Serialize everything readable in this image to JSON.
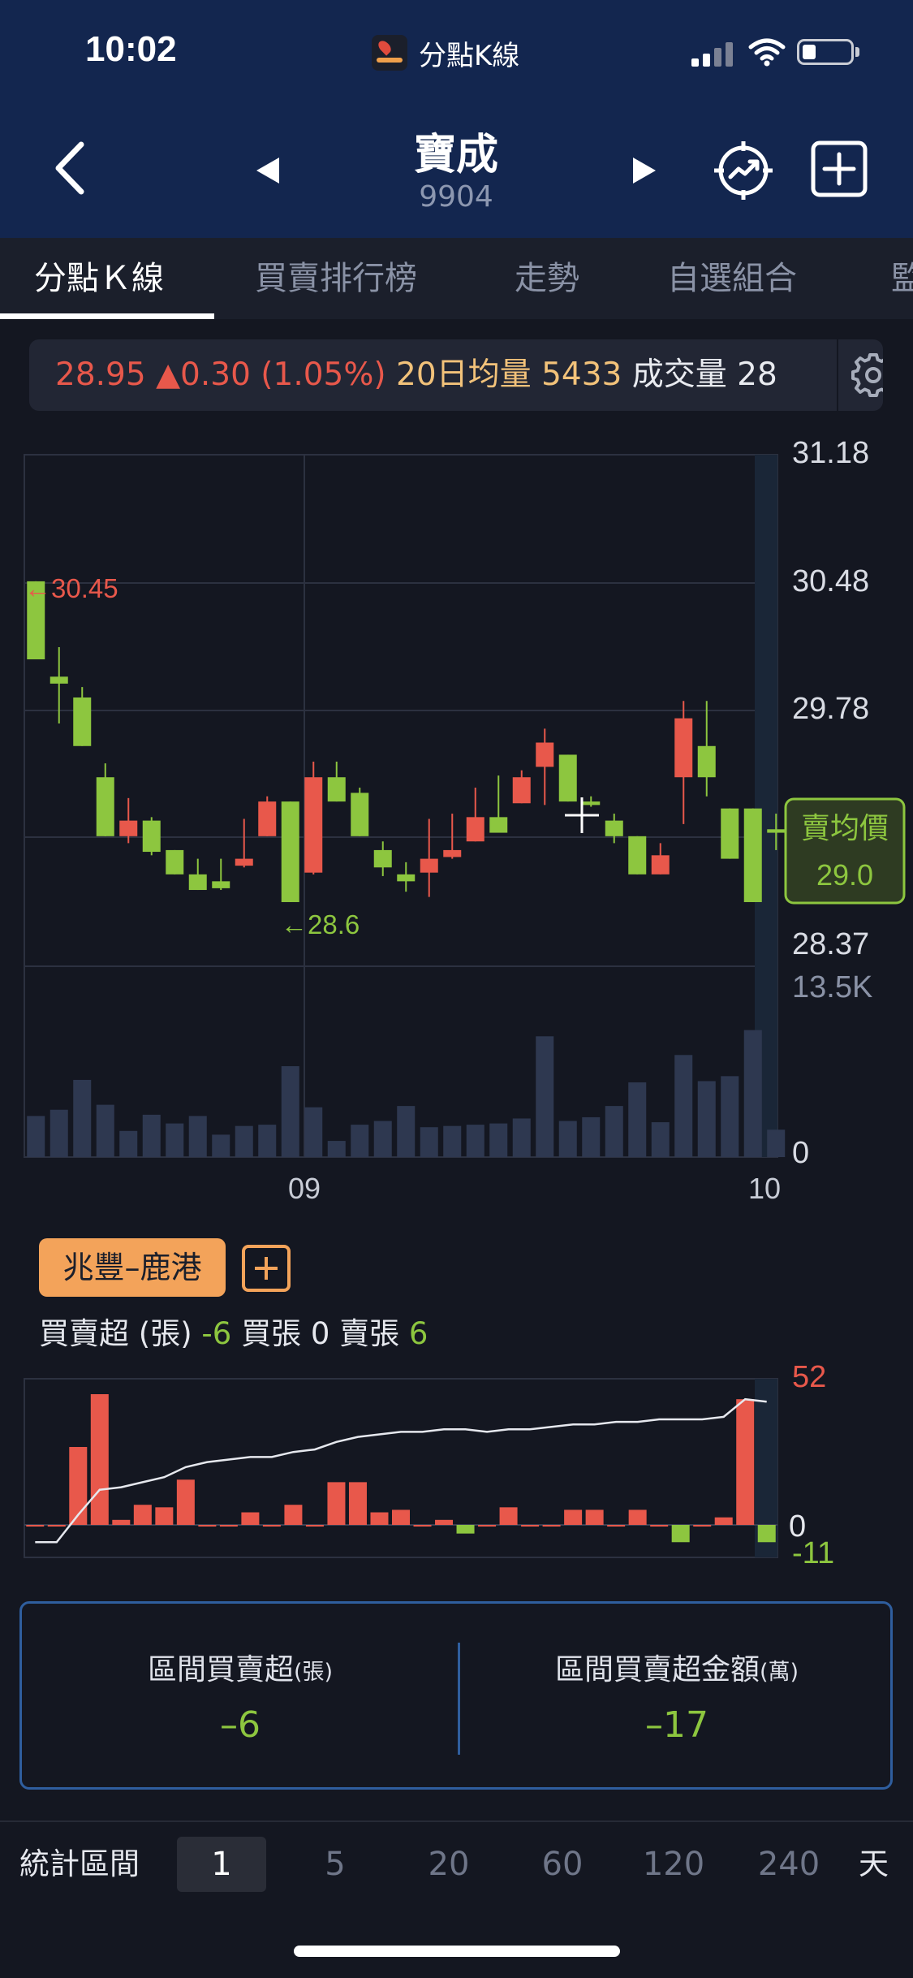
{
  "status_bar": {
    "time": "10:02",
    "app_name": "分點K線"
  },
  "header": {
    "stock_name": "寶成",
    "stock_code": "9904"
  },
  "tabs": [
    {
      "label": "分點Ｋ線",
      "active": true
    },
    {
      "label": "買賣排行榜",
      "active": false
    },
    {
      "label": "走勢",
      "active": false
    },
    {
      "label": "自選組合",
      "active": false
    },
    {
      "label": "監",
      "active": false
    }
  ],
  "ticker": {
    "price": "28.95",
    "change": "▲0.30 (1.05%)",
    "avg_label": "20日均量",
    "avg_value": "5433",
    "volume_label": "成交量",
    "volume_value": "28"
  },
  "colors": {
    "up": "#e8584b",
    "down": "#8dc63f",
    "accent": "#f3a35a",
    "volume": "#2e3850",
    "header": "#13264f"
  },
  "chart_data": [
    {
      "type": "candlestick",
      "y_ticks": [
        "31.18",
        "30.48",
        "29.78",
        "28.37"
      ],
      "ylim": [
        28.23,
        31.18
      ],
      "volume_ticks": [
        "13.5K",
        "0"
      ],
      "volume_max": 13500,
      "x_ticks": [
        "09",
        "10"
      ],
      "high_label": "30.45",
      "low_label": "28.6",
      "badge": {
        "label": "賣均價",
        "value": "29.0"
      },
      "candles": [
        {
          "o": 30.45,
          "c": 30.0,
          "h": 30.45,
          "l": 30.0,
          "v": 3300
        },
        {
          "o": 29.9,
          "c": 29.86,
          "h": 30.07,
          "l": 29.63,
          "v": 3800
        },
        {
          "o": 29.78,
          "c": 29.5,
          "h": 29.84,
          "l": 29.5,
          "v": 6200
        },
        {
          "o": 29.32,
          "c": 28.98,
          "h": 29.4,
          "l": 28.98,
          "v": 4200
        },
        {
          "o": 28.98,
          "c": 29.07,
          "h": 29.2,
          "l": 28.94,
          "v": 2100
        },
        {
          "o": 29.07,
          "c": 28.89,
          "h": 29.09,
          "l": 28.87,
          "v": 3400
        },
        {
          "o": 28.9,
          "c": 28.76,
          "h": 28.9,
          "l": 28.76,
          "v": 2700
        },
        {
          "o": 28.76,
          "c": 28.67,
          "h": 28.85,
          "l": 28.67,
          "v": 3300
        },
        {
          "o": 28.72,
          "c": 28.68,
          "h": 28.85,
          "l": 28.67,
          "v": 1800
        },
        {
          "o": 28.81,
          "c": 28.85,
          "h": 29.08,
          "l": 28.8,
          "v": 2500
        },
        {
          "o": 28.98,
          "c": 29.18,
          "h": 29.21,
          "l": 28.98,
          "v": 2600
        },
        {
          "o": 29.18,
          "c": 28.6,
          "h": 29.18,
          "l": 28.6,
          "v": 7300
        },
        {
          "o": 28.77,
          "c": 29.32,
          "h": 29.41,
          "l": 28.76,
          "v": 4000
        },
        {
          "o": 29.32,
          "c": 29.18,
          "h": 29.41,
          "l": 29.18,
          "v": 1300
        },
        {
          "o": 29.23,
          "c": 28.98,
          "h": 29.26,
          "l": 28.98,
          "v": 2600
        },
        {
          "o": 28.9,
          "c": 28.8,
          "h": 28.95,
          "l": 28.75,
          "v": 2900
        },
        {
          "o": 28.76,
          "c": 28.72,
          "h": 28.83,
          "l": 28.66,
          "v": 4100
        },
        {
          "o": 28.77,
          "c": 28.85,
          "h": 29.08,
          "l": 28.63,
          "v": 2400
        },
        {
          "o": 28.86,
          "c": 28.9,
          "h": 29.11,
          "l": 28.85,
          "v": 2500
        },
        {
          "o": 28.95,
          "c": 29.09,
          "h": 29.26,
          "l": 28.95,
          "v": 2600
        },
        {
          "o": 29.09,
          "c": 29.0,
          "h": 29.33,
          "l": 29.0,
          "v": 2700
        },
        {
          "o": 29.17,
          "c": 29.32,
          "h": 29.36,
          "l": 29.17,
          "v": 3100
        },
        {
          "o": 29.38,
          "c": 29.52,
          "h": 29.6,
          "l": 29.16,
          "v": 9700
        },
        {
          "o": 29.45,
          "c": 29.18,
          "h": 29.45,
          "l": 29.18,
          "v": 2900
        },
        {
          "o": 29.18,
          "c": 29.16,
          "h": 29.21,
          "l": 29.15,
          "v": 3200
        },
        {
          "o": 29.07,
          "c": 28.98,
          "h": 29.11,
          "l": 28.94,
          "v": 4100
        },
        {
          "o": 28.98,
          "c": 28.76,
          "h": 28.98,
          "l": 28.76,
          "v": 6000
        },
        {
          "o": 28.76,
          "c": 28.87,
          "h": 28.94,
          "l": 28.76,
          "v": 2800
        },
        {
          "o": 29.32,
          "c": 29.66,
          "h": 29.76,
          "l": 29.05,
          "v": 8200
        },
        {
          "o": 29.5,
          "c": 29.32,
          "h": 29.76,
          "l": 29.21,
          "v": 6100
        },
        {
          "o": 29.14,
          "c": 28.85,
          "h": 29.14,
          "l": 28.85,
          "v": 6500
        },
        {
          "o": 29.14,
          "c": 28.6,
          "h": 29.14,
          "l": 28.6,
          "v": 10200
        },
        {
          "o": 29.02,
          "c": 29.0,
          "h": 29.11,
          "l": 28.9,
          "v": 2200
        }
      ]
    },
    {
      "type": "bar",
      "title": "買賣超 (張)",
      "y_ticks": [
        "52",
        "0",
        "-11"
      ],
      "ylim": [
        -11,
        52
      ],
      "values": [
        0,
        0,
        31,
        52,
        2,
        8,
        7,
        18,
        0,
        0,
        5,
        0,
        8,
        0,
        17,
        17,
        5,
        6,
        0,
        2,
        -3,
        0,
        7,
        0,
        0,
        6,
        6,
        0,
        6,
        0,
        -6,
        0,
        3,
        50,
        -6
      ],
      "cumulative": [
        -6,
        -6,
        4,
        14,
        15,
        17,
        19,
        23,
        25,
        26,
        27,
        27,
        29,
        30,
        33,
        35,
        36,
        37,
        37,
        38,
        38,
        37,
        38,
        38,
        39,
        40,
        40,
        41,
        41,
        42,
        42,
        42,
        43,
        50,
        49
      ]
    }
  ],
  "broker": {
    "name": "兆豐–鹿港",
    "net_label": "買賣超 (張)",
    "net_value": "-6",
    "buy_label": "買張",
    "buy_value": "0",
    "sell_label": "賣張",
    "sell_value": "6"
  },
  "summary": {
    "left": {
      "label": "區間買賣超",
      "unit": "(張)",
      "value": "–6"
    },
    "right": {
      "label": "區間買賣超金額",
      "unit": "(萬)",
      "value": "–17"
    }
  },
  "period": {
    "label": "統計區間",
    "options": [
      "1",
      "5",
      "20",
      "60",
      "120",
      "240"
    ],
    "active_index": 0,
    "unit": "天"
  }
}
